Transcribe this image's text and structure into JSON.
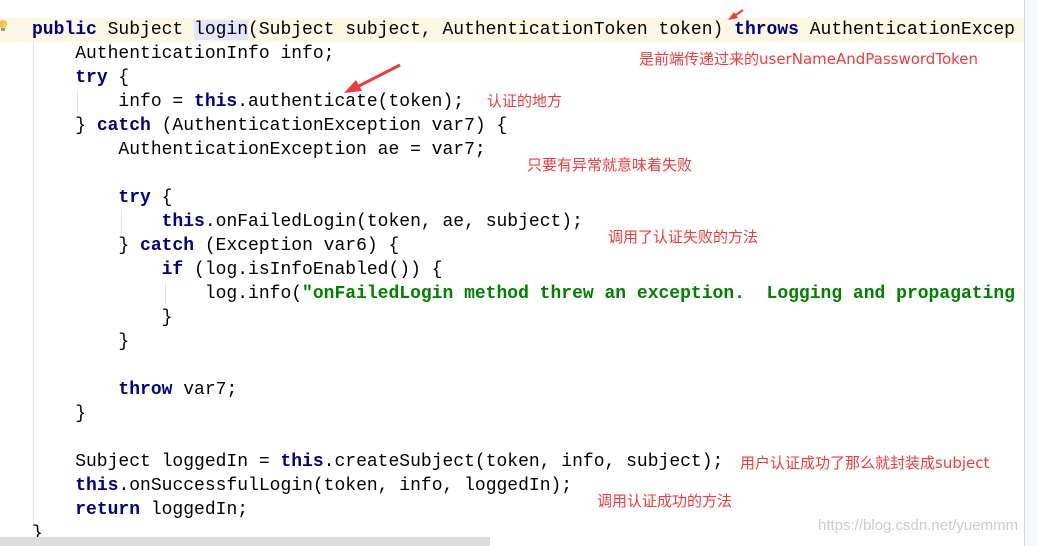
{
  "code": {
    "lines": [
      [
        [
          "public",
          "kw"
        ],
        [
          " Subject ",
          ""
        ],
        [
          "login",
          "hl"
        ],
        [
          "(Subject subject, AuthenticationToken token) ",
          ""
        ],
        [
          "throws",
          "kw"
        ],
        [
          " AuthenticationExcep",
          ""
        ]
      ],
      [
        [
          "    AuthenticationInfo info;",
          ""
        ]
      ],
      [
        [
          "    ",
          ""
        ],
        [
          "try",
          "kw"
        ],
        [
          " {",
          ""
        ]
      ],
      [
        [
          "        info = ",
          ""
        ],
        [
          "this",
          "kw"
        ],
        [
          ".authenticate(token);",
          ""
        ]
      ],
      [
        [
          "    } ",
          ""
        ],
        [
          "catch",
          "kw"
        ],
        [
          " (AuthenticationException var7) {",
          ""
        ]
      ],
      [
        [
          "        AuthenticationException ae = var7;",
          ""
        ]
      ],
      [
        [
          "",
          ""
        ]
      ],
      [
        [
          "        ",
          ""
        ],
        [
          "try",
          "kw"
        ],
        [
          " {",
          ""
        ]
      ],
      [
        [
          "            ",
          ""
        ],
        [
          "this",
          "kw"
        ],
        [
          ".onFailedLogin(token, ae, subject);",
          ""
        ]
      ],
      [
        [
          "        } ",
          ""
        ],
        [
          "catch",
          "kw"
        ],
        [
          " (Exception var6) {",
          ""
        ]
      ],
      [
        [
          "            ",
          ""
        ],
        [
          "if",
          "kw"
        ],
        [
          " (log.isInfoEnabled()) {",
          ""
        ]
      ],
      [
        [
          "                log.info(",
          ""
        ],
        [
          "\"onFailedLogin method threw an exception.  Logging and propagating",
          "str"
        ]
      ],
      [
        [
          "            }",
          ""
        ]
      ],
      [
        [
          "        }",
          ""
        ]
      ],
      [
        [
          "",
          ""
        ]
      ],
      [
        [
          "        ",
          ""
        ],
        [
          "throw",
          "kw"
        ],
        [
          " var7;",
          ""
        ]
      ],
      [
        [
          "    }",
          ""
        ]
      ],
      [
        [
          "",
          ""
        ]
      ],
      [
        [
          "    Subject loggedIn = ",
          ""
        ],
        [
          "this",
          "kw"
        ],
        [
          ".createSubject(token, info, subject);",
          ""
        ]
      ],
      [
        [
          "    ",
          ""
        ],
        [
          "this",
          "kw"
        ],
        [
          ".onSuccessfulLogin(token, info, loggedIn);",
          ""
        ]
      ],
      [
        [
          "    ",
          ""
        ],
        [
          "return",
          "kw"
        ],
        [
          " loggedIn;",
          ""
        ]
      ],
      [
        [
          "}",
          ""
        ]
      ]
    ]
  },
  "annotations": [
    {
      "text": "是前端传递过来的userNameAndPasswordToken"
    },
    {
      "text": "认证的地方"
    },
    {
      "text": "只要有异常就意味着失败"
    },
    {
      "text": "调用了认证失败的方法"
    },
    {
      "text": "用户认证成功了那么就封装成subject"
    },
    {
      "text": "调用认证成功的方法"
    }
  ],
  "watermark": "https://blog.csdn.net/yuemmm",
  "colors": {
    "keyword": "#000080",
    "string": "#008000",
    "annotation": "#f03c3c",
    "current_line": "#fdf8e3"
  },
  "icons": {
    "gutter": "lightbulb-icon",
    "annotation_marker": "arrow-icon"
  }
}
